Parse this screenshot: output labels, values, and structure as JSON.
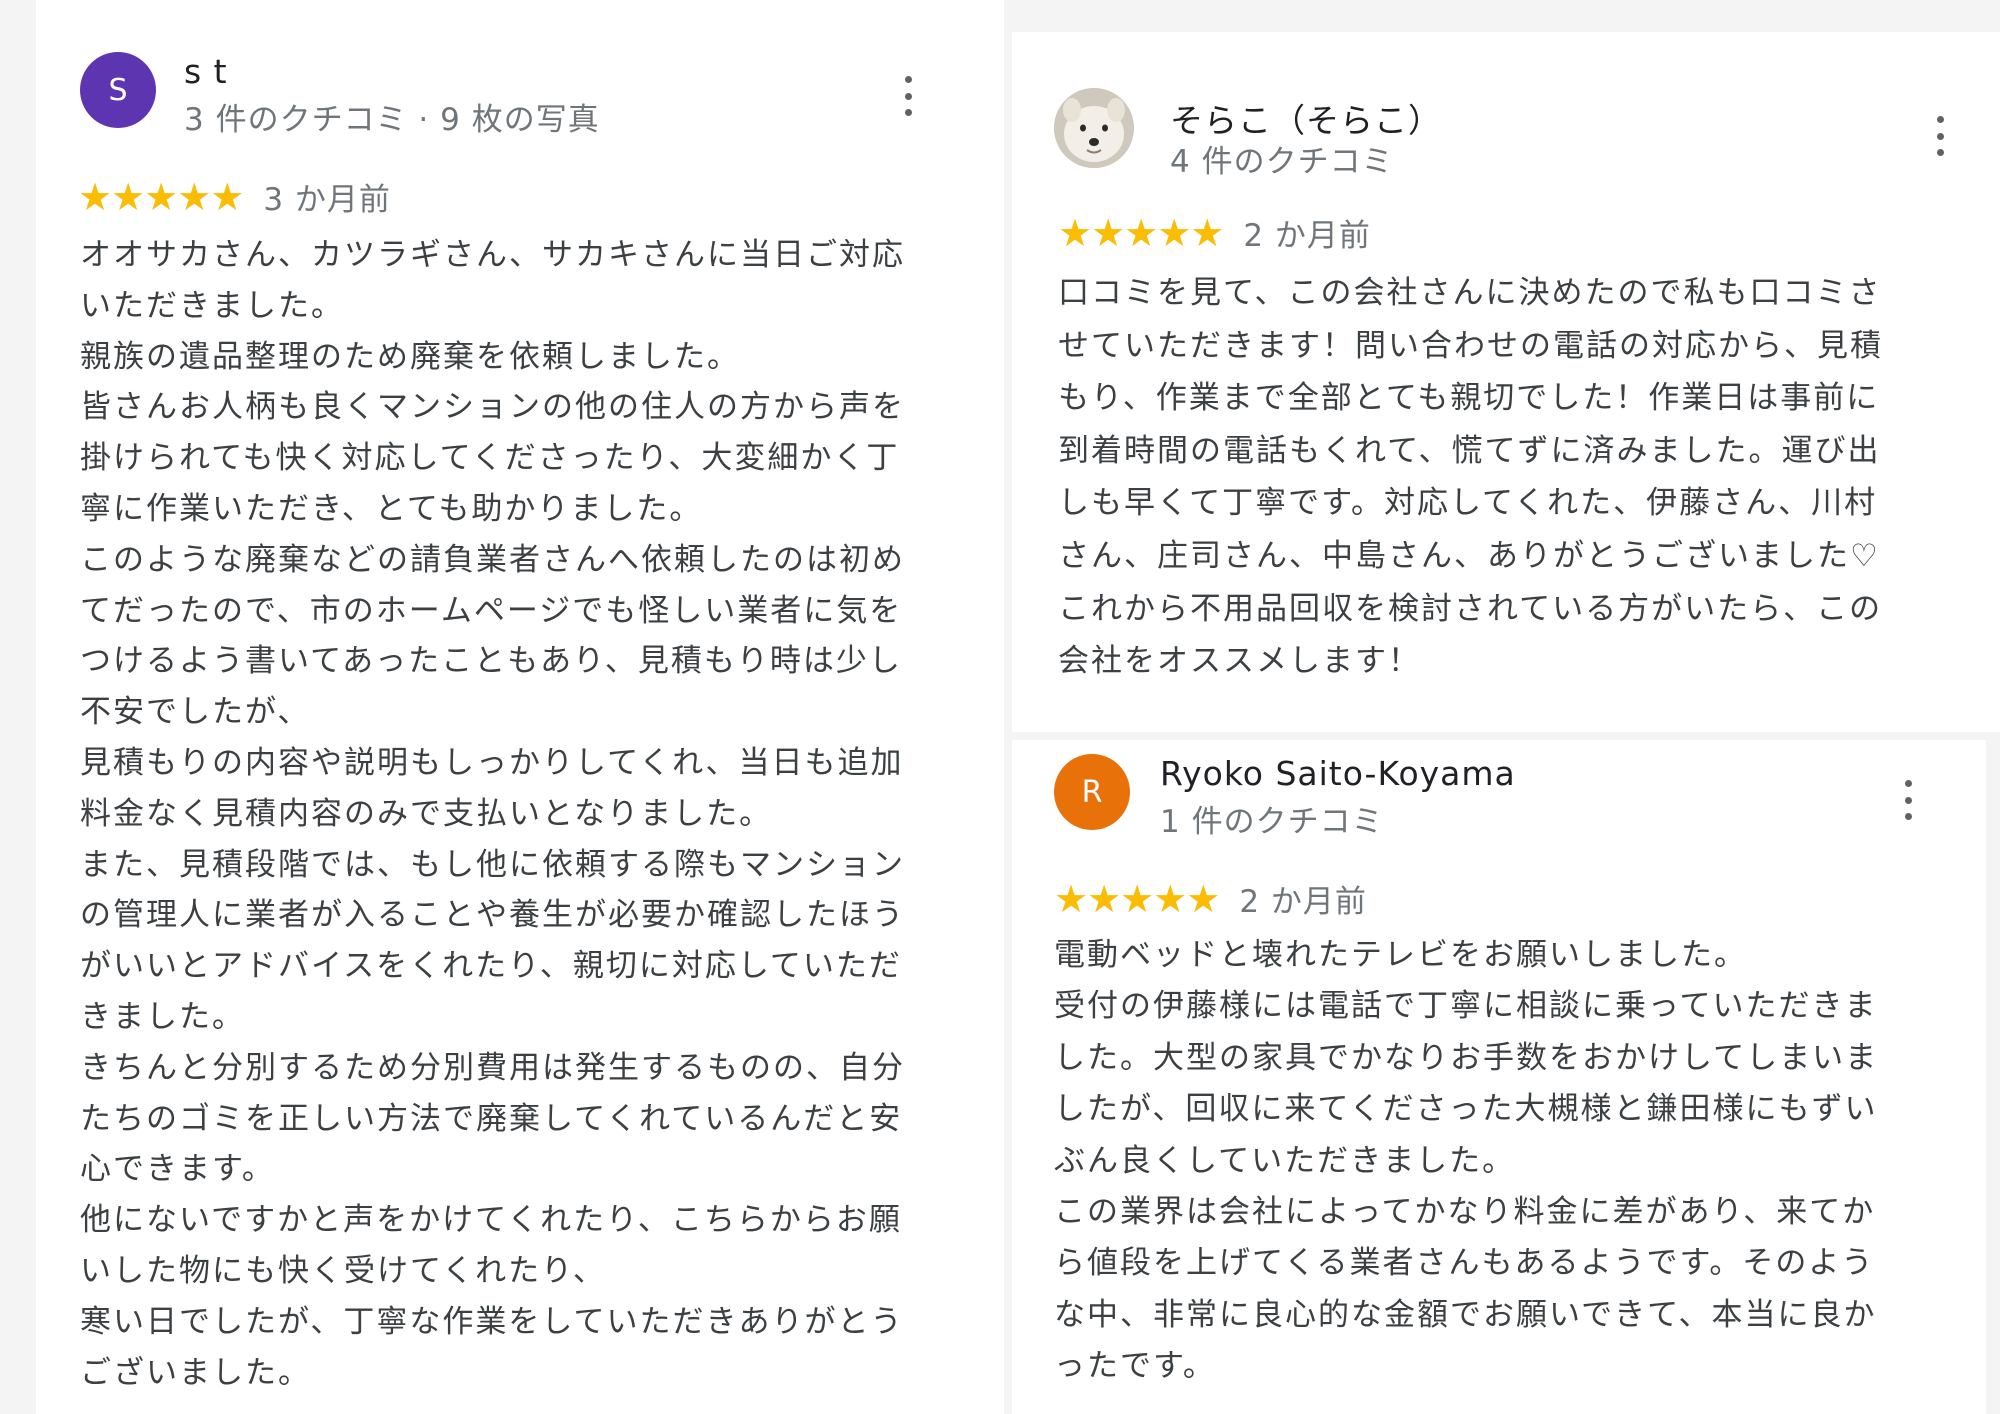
{
  "reviews": [
    {
      "avatar_letter": "S",
      "avatar_color": "#5e35b1",
      "name": "s t",
      "meta": "3 件のクチコミ · 9 枚の写真",
      "stars": "★★★★★",
      "rating": 5,
      "date": "3 か月前",
      "lines": [
        "オオサカさん、カツラギさん、サカキさんに当日ご対応",
        "いただきました。",
        "親族の遺品整理のため廃棄を依頼しました。",
        "皆さんお人柄も良くマンションの他の住人の方から声を",
        "掛けられても快く対応してくださったり、大変細かく丁",
        "寧に作業いただき、とても助かりました。",
        "このような廃棄などの請負業者さんへ依頼したのは初め",
        "てだったので、市のホームページでも怪しい業者に気を",
        "つけるよう書いてあったこともあり、見積もり時は少し",
        "不安でしたが、",
        "見積もりの内容や説明もしっかりしてくれ、当日も追加",
        "料金なく見積内容のみで支払いとなりました。",
        "また、見積段階では、もし他に依頼する際もマンション",
        "の管理人に業者が入ることや養生が必要か確認したほう",
        "がいいとアドバイスをくれたり、親切に対応していただ",
        "きました。",
        "きちんと分別するため分別費用は発生するものの、自分",
        "たちのゴミを正しい方法で廃棄してくれているんだと安",
        "心できます。",
        "他にないですかと声をかけてくれたり、こちらからお願",
        "いした物にも快く受けてくれたり、",
        "寒い日でしたが、丁寧な作業をしていただきありがとう",
        "ございました。"
      ]
    },
    {
      "name": "そらこ（そらこ）",
      "meta": "4 件のクチコミ",
      "stars": "★★★★★",
      "rating": 5,
      "date": "2 か月前",
      "lines": [
        "口コミを見て、この会社さんに決めたので私も口コミさ",
        "せていただきます！問い合わせの電話の対応から、見積",
        "もり、作業まで全部とても親切でした！作業日は事前に",
        "到着時間の電話もくれて、慌てずに済みました。運び出",
        "しも早くて丁寧です。対応してくれた、伊藤さん、川村",
        "さん、庄司さん、中島さん、ありがとうございました♡",
        "これから不用品回収を検討されている方がいたら、この",
        "会社をオススメします！"
      ]
    },
    {
      "avatar_letter": "R",
      "avatar_color": "#e8710a",
      "name": "Ryoko Saito-Koyama",
      "meta": "1 件のクチコミ",
      "stars": "★★★★★",
      "rating": 5,
      "date": "2 か月前",
      "lines": [
        "電動ベッドと壊れたテレビをお願いしました。",
        "受付の伊藤様には電話で丁寧に相談に乗っていただきま",
        "した。大型の家具でかなりお手数をおかけしてしまいま",
        "したが、回収に来てくださった大槻様と鎌田様にもずい",
        "ぶん良くしていただきました。",
        "この業界は会社によってかなり料金に差があり、来てか",
        "ら値段を上げてくる業者さんもあるようです。そのよう",
        "な中、非常に良心的な金額でお願いできて、本当に良か",
        "ったです。"
      ]
    }
  ]
}
